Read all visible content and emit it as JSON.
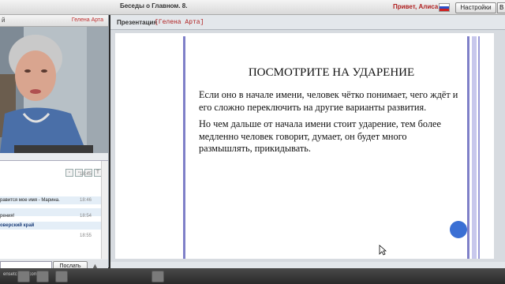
{
  "window": {
    "title": "Беседы о Главном. 8.",
    "greeting": "Привет, Алиса",
    "settings_label": "Настройки",
    "exit_label": "В"
  },
  "webcam": {
    "header_symbol": "й",
    "presenter_name": "Гелена Арта"
  },
  "chat": {
    "messages": [
      {
        "text": "",
        "time": "18:45"
      },
      {
        "text": "равится мое имя - Марина.",
        "time": "18:46"
      },
      {
        "text": "",
        "time": ""
      },
      {
        "text": "рения!",
        "time": "18:54"
      },
      {
        "text": "оверский край",
        "time": ""
      },
      {
        "text": "",
        "time": "18:55"
      }
    ],
    "send_label": "Послать"
  },
  "presentation": {
    "label": "Презентация",
    "presenter_tag": "[Гелена Арта]",
    "slide_title": "ПОСМОТРИТЕ НА УДАРЕНИЕ",
    "paragraphs": [
      "Если оно в начале имени, человек чётко понимает, чего ждёт и его сложно переключить на другие варианты развития.",
      "Но чем дальше от начала имени стоит ударение, тем более медленно человек говорит, думает, он будет много размышлять, прикидывать."
    ]
  },
  "taskbar": {
    "url_fragment": "ensetchaya.com"
  },
  "colors": {
    "accent_red": "#b02020",
    "slide_line": "#7f80c8",
    "pointer_dot": "#3a6fd4"
  }
}
